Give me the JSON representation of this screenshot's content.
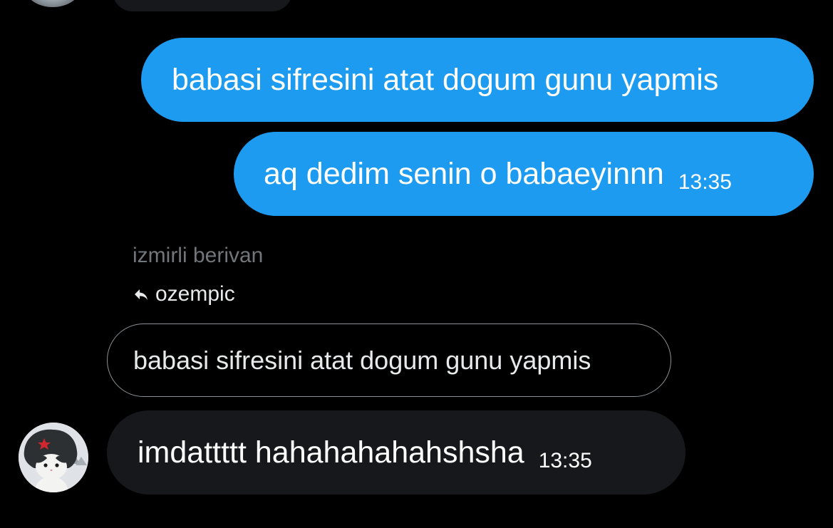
{
  "messages": {
    "outgoing": [
      {
        "text": "babasi sifresini atat dogum gunu yapmis"
      },
      {
        "text": "aq dedim senin o babaeyinnn",
        "time": "13:35"
      }
    ],
    "incoming": {
      "sender_name": "izmirli berivan",
      "reply_to_name": "ozempic",
      "quoted_text": "babasi sifresini atat dogum gunu yapmis",
      "text": "imdattttt hahahahahahshsha",
      "time": "13:35"
    }
  },
  "icons": {
    "reply": "reply-arrow-icon",
    "avatar": "cat-avatar"
  },
  "colors": {
    "background": "#000000",
    "outgoing_bubble": "#1d9bf0",
    "incoming_bubble": "#16181c",
    "muted_text": "#71767b",
    "text": "#e7e9ea"
  }
}
